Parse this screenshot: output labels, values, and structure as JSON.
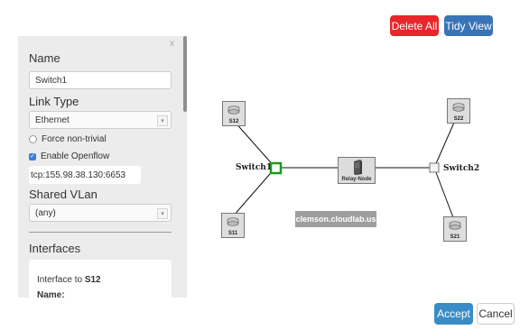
{
  "toolbar": {
    "delete_all": "Delete All",
    "tidy_view": "Tidy View"
  },
  "panel": {
    "close": "x",
    "name_label": "Name",
    "name_value": "Switch1",
    "link_type_label": "Link Type",
    "link_type_value": "Ethernet",
    "force_non_trivial": "Force non-trivial",
    "enable_openflow": "Enable Openflow",
    "openflow_url": "tcp:155.98.38.130:6653",
    "shared_vlan_label": "Shared VLan",
    "shared_vlan_value": "(any)",
    "interfaces_label": "Interfaces",
    "interface_title_prefix": "Interface to ",
    "interface_target": "S12",
    "interface_name_label": "Name:"
  },
  "topology": {
    "nodes": {
      "s12": "S12",
      "s11": "S11",
      "s22": "S22",
      "s21": "S21",
      "relay": "Relay-Node"
    },
    "switch1": "Switch1",
    "switch2": "Switch2",
    "site": "clemson.cloudlab.us",
    "colors": {
      "selected_switch": "#1a9a1a",
      "line": "#111111"
    }
  },
  "footer": {
    "accept": "Accept",
    "cancel": "Cancel"
  }
}
